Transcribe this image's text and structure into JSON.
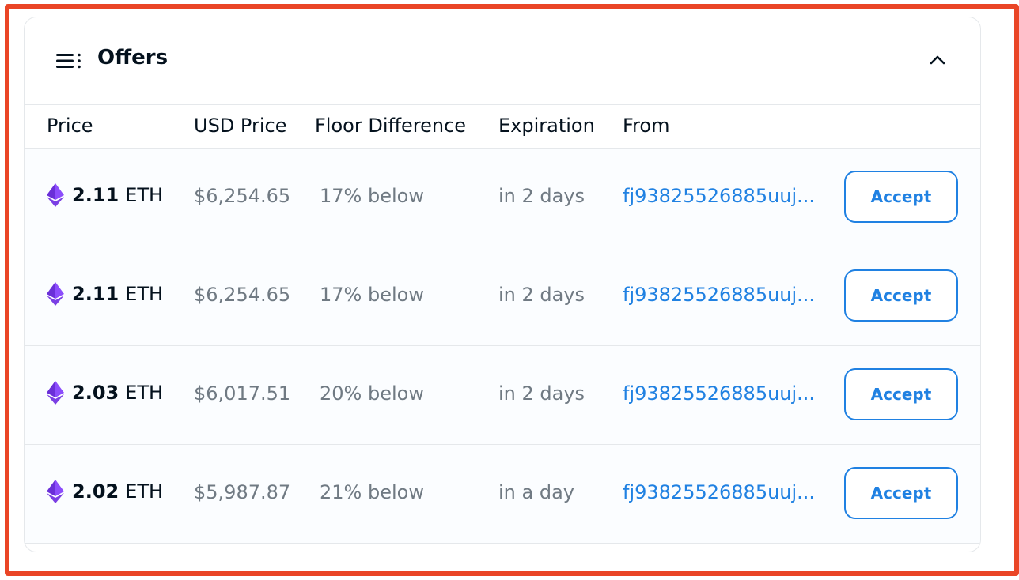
{
  "panel": {
    "title": "Offers"
  },
  "table": {
    "columns": [
      "Price",
      "USD Price",
      "Floor Difference",
      "Expiration",
      "From"
    ],
    "rows": [
      {
        "price": "2.11",
        "unit": "ETH",
        "usd": "$6,254.65",
        "floor": "17% below",
        "expiration": "in 2 days",
        "from": "fj93825526885uuj...",
        "action": "Accept"
      },
      {
        "price": "2.11",
        "unit": "ETH",
        "usd": "$6,254.65",
        "floor": "17% below",
        "expiration": "in 2 days",
        "from": "fj93825526885uuj...",
        "action": "Accept"
      },
      {
        "price": "2.03",
        "unit": "ETH",
        "usd": "$6,017.51",
        "floor": "20% below",
        "expiration": "in 2 days",
        "from": "fj93825526885uuj...",
        "action": "Accept"
      },
      {
        "price": "2.02",
        "unit": "ETH",
        "usd": "$5,987.87",
        "floor": "21% below",
        "expiration": "in a day",
        "from": "fj93825526885uuj...",
        "action": "Accept"
      }
    ]
  },
  "icons": {
    "header": "list-icon",
    "collapse": "chevron-up-icon",
    "currency": "ethereum-icon"
  },
  "colors": {
    "accent": "#2081e2",
    "highlight_border": "#ea4526",
    "eth": "#7b3fe4"
  }
}
